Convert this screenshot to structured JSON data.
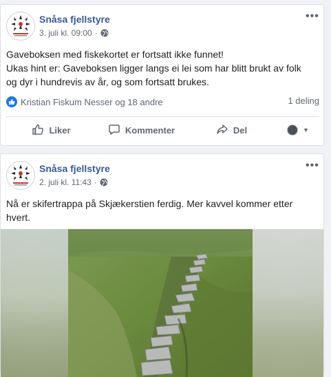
{
  "posts": [
    {
      "page_name": "Snåsa fjellstyre",
      "date": "3. juli kl. 09:00",
      "text_lines": [
        "Gaveboksen med fiskekortet er fortsatt ikke funnet!",
        "Ukas hint er: Gaveboksen ligger langs ei lei som har blitt brukt av folk",
        "og dyr i hundrevis av år, og som fortsatt brukes."
      ],
      "reactions_text": "Kristian Fiskum Nesser og 18 andre",
      "shares_text": "1 deling",
      "actions": {
        "like": "Liker",
        "comment": "Kommenter",
        "share": "Del"
      }
    },
    {
      "page_name": "Snåsa fjellstyre",
      "date": "2. juli kl. 11:43",
      "text_lines": [
        "Nå er skifertrappa på Skjækerstien ferdig. Mer kavvel kommer etter",
        "hvert."
      ]
    }
  ],
  "icons": {
    "privacy": "globe-icon",
    "more": "more-options-icon",
    "like_badge": "thumbs-up-icon",
    "like_action": "thumbs-up-outline-icon",
    "comment_action": "comment-icon",
    "share_action": "share-arrow-icon"
  },
  "colors": {
    "page_name": "#385898",
    "like_badge": "#1877f2",
    "secondary_text": "#606770"
  }
}
